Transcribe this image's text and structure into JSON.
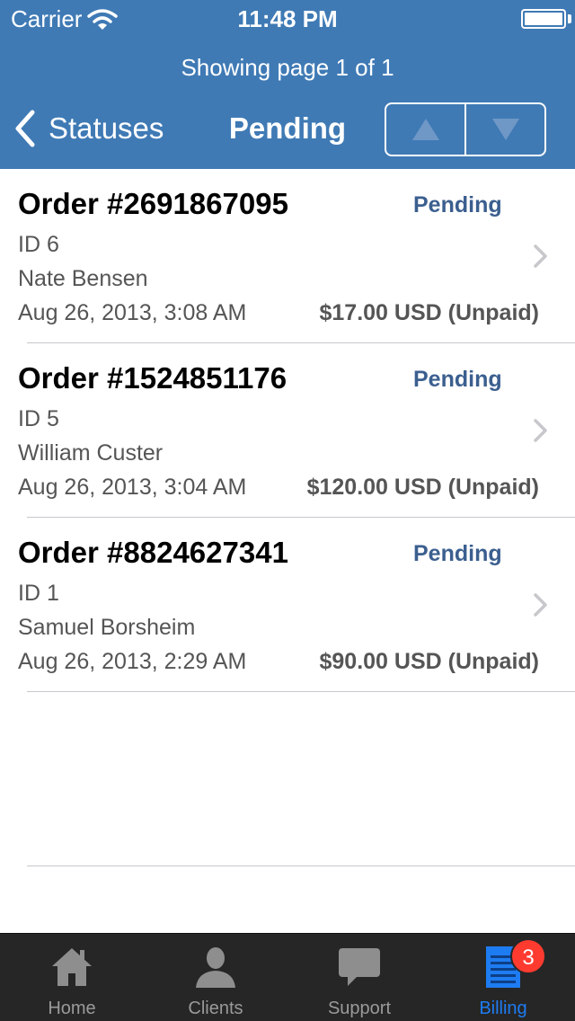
{
  "status_bar": {
    "carrier": "Carrier",
    "time": "11:48 PM",
    "wifi_icon": "wifi-icon",
    "battery_icon": "battery-icon"
  },
  "header": {
    "page_info": "Showing page 1 of 1",
    "back_label": "Statuses",
    "title": "Pending",
    "prev_icon": "triangle-up-icon",
    "next_icon": "triangle-down-icon",
    "background_color": "#3f7ab5"
  },
  "orders": [
    {
      "title": "Order #2691867095",
      "status": "Pending",
      "id": "ID 6",
      "client": "Nate Bensen",
      "date": "Aug 26, 2013, 3:08 AM",
      "amount": "$17.00 USD (Unpaid)"
    },
    {
      "title": "Order #1524851176",
      "status": "Pending",
      "id": "ID 5",
      "client": "William Custer",
      "date": "Aug 26, 2013, 3:04 AM",
      "amount": "$120.00 USD (Unpaid)"
    },
    {
      "title": "Order #8824627341",
      "status": "Pending",
      "id": "ID 1",
      "client": "Samuel Borsheim",
      "date": "Aug 26, 2013, 2:29 AM",
      "amount": "$90.00 USD (Unpaid)"
    }
  ],
  "tabbar": {
    "items": [
      {
        "label": "Home",
        "icon": "home-icon"
      },
      {
        "label": "Clients",
        "icon": "person-icon"
      },
      {
        "label": "Support",
        "icon": "speech-bubble-icon"
      },
      {
        "label": "Billing",
        "icon": "document-icon"
      }
    ],
    "active_index": 3,
    "billing_badge": "3",
    "active_color": "#1e7cf2"
  }
}
